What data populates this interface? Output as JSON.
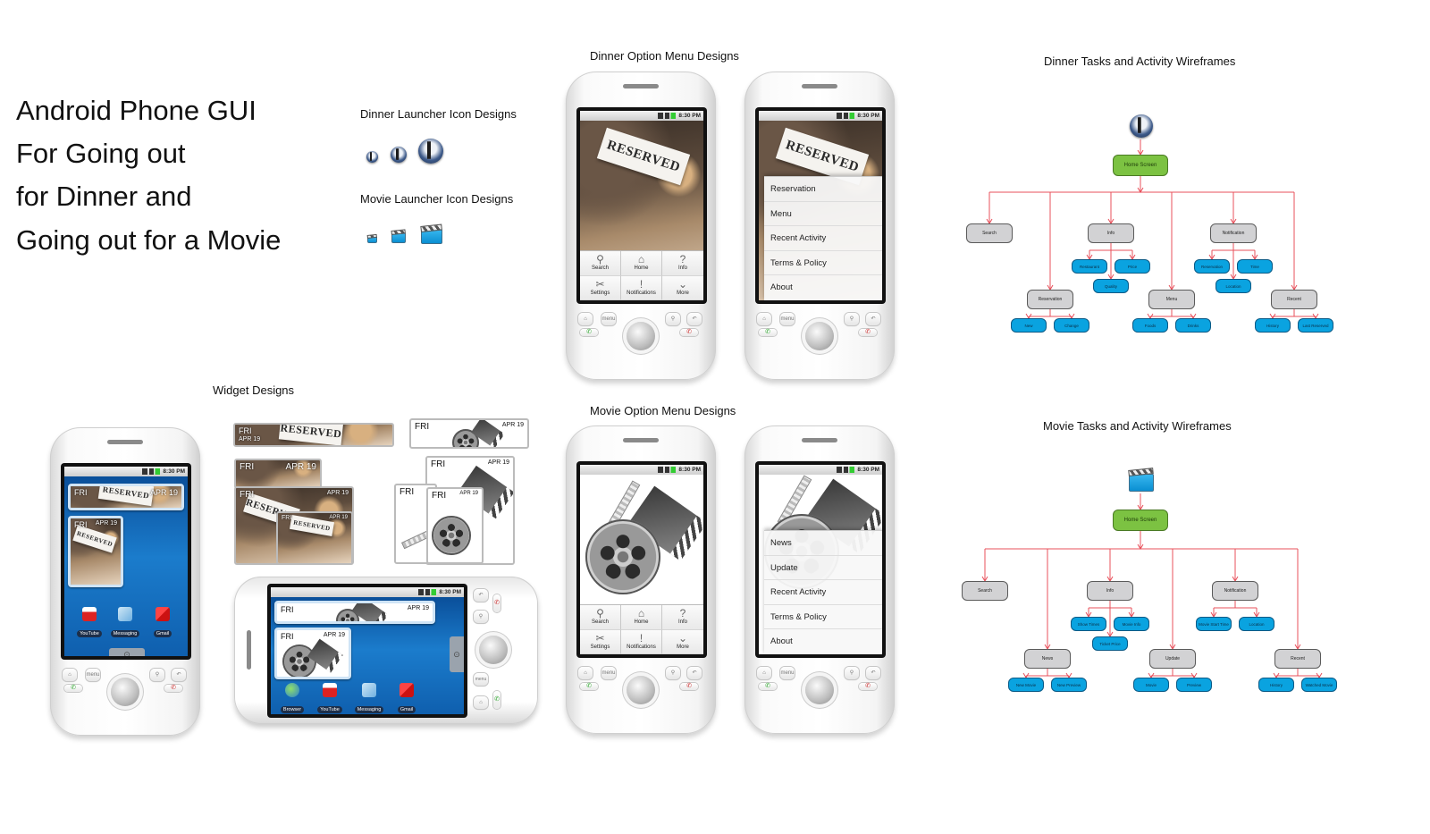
{
  "title_lines": [
    "Android Phone GUI",
    "For Going out",
    "for Dinner and",
    "Going out for a Movie"
  ],
  "captions": {
    "dinner_launcher": "Dinner Launcher Icon Designs",
    "movie_launcher": "Movie Launcher Icon Designs",
    "dinner_option_menu": "Dinner Option Menu Designs",
    "movie_option_menu": "Movie Option Menu Designs",
    "widget_designs": "Widget Designs",
    "dinner_wireframes": "Dinner Tasks and Activity Wireframes",
    "movie_wireframes": "Movie Tasks and Activity Wireframes"
  },
  "status_time": "8:30 PM",
  "reserved_sign": "RESERVED",
  "widget": {
    "day": "FRI",
    "date": "APR 19",
    "date_spaced": "APR  19"
  },
  "main_menu": [
    {
      "label": "Search",
      "icon": "search-icon",
      "glyph": "⚲"
    },
    {
      "label": "Home",
      "icon": "home-icon",
      "glyph": "⌂"
    },
    {
      "label": "Info",
      "icon": "info-icon",
      "glyph": "?"
    },
    {
      "label": "Settings",
      "icon": "settings-icon",
      "glyph": "✂"
    },
    {
      "label": "Notifications",
      "icon": "notifications-icon",
      "glyph": "!"
    },
    {
      "label": "More",
      "icon": "more-icon",
      "glyph": "⌄"
    }
  ],
  "dinner_options": [
    "Reservation",
    "Menu",
    "Recent Activity",
    "Terms & Policy",
    "About"
  ],
  "movie_options": [
    "News",
    "Update",
    "Recent Activity",
    "Terms & Policy",
    "About"
  ],
  "hw_buttons": {
    "home": "⌂",
    "menu": "menu",
    "search": "⚲",
    "back": "↶",
    "call": "✆",
    "end": "✆"
  },
  "home_apps": [
    "YouTube",
    "Messaging",
    "Gmail"
  ],
  "landscape_apps": [
    "Browser",
    "YouTube",
    "Messaging",
    "Gmail"
  ],
  "dinner_tree": {
    "root": "Home Screen",
    "nodes": [
      {
        "label": "Search",
        "children": []
      },
      {
        "label": "Reservation",
        "children": [
          "New",
          "Change"
        ]
      },
      {
        "label": "Info",
        "children": [
          "Restaurant",
          "Price",
          "Quality"
        ]
      },
      {
        "label": "Menu",
        "children": [
          "Foods",
          "Drinks"
        ]
      },
      {
        "label": "Notification",
        "children": [
          "Reservation",
          "Time",
          "Location"
        ]
      },
      {
        "label": "Recent",
        "children": [
          "History",
          "Last Reserved"
        ]
      }
    ]
  },
  "movie_tree": {
    "root": "Home Screen",
    "nodes": [
      {
        "label": "Search",
        "children": []
      },
      {
        "label": "News",
        "children": [
          "New Movie",
          "New Preview"
        ]
      },
      {
        "label": "Info",
        "children": [
          "Show Times",
          "Movie Info",
          "Ticket Price"
        ]
      },
      {
        "label": "Update",
        "children": [
          "Movie",
          "Preview"
        ]
      },
      {
        "label": "Notification",
        "children": [
          "Movie Start Time",
          "Location"
        ]
      },
      {
        "label": "Recent",
        "children": [
          "History",
          "Watched Movie"
        ]
      }
    ]
  },
  "colors": {
    "root_node": "#7cc242",
    "category_node": "#d2d2d4",
    "leaf_node": "#0aa3e0",
    "connector": "#e8505b",
    "home_screen_bg": "#1b7ccc"
  }
}
